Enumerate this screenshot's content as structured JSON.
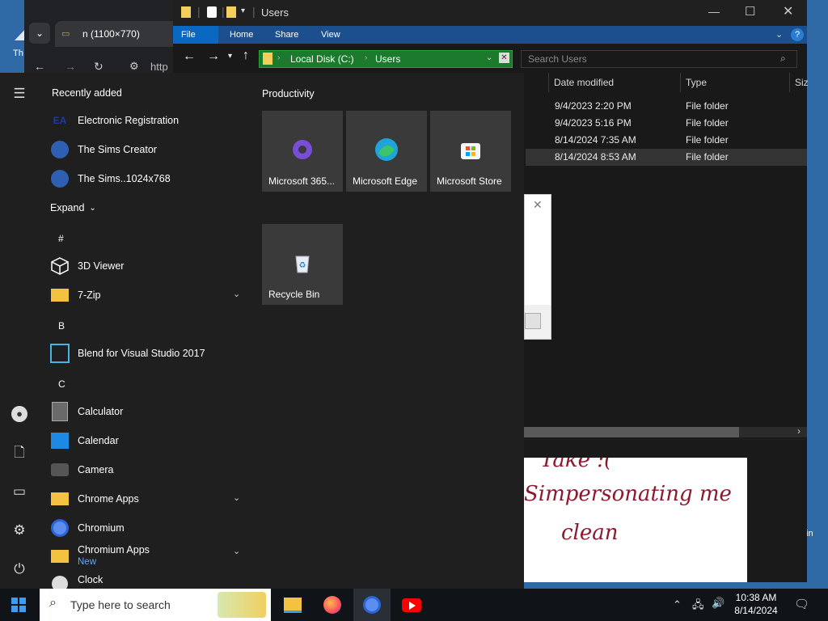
{
  "desktop": {
    "label_left": "Th",
    "label_right": "in"
  },
  "browser": {
    "tab_title": "n (1100×770)",
    "url_fragment": "http"
  },
  "explorer": {
    "title": "Users",
    "ribbon_tabs": [
      "File",
      "Home",
      "Share",
      "View"
    ],
    "address": {
      "segment1": "Local Disk (C:)",
      "segment2": "Users"
    },
    "search_placeholder": "Search Users",
    "columns": [
      "Date modified",
      "Type",
      "Siz"
    ],
    "rows": [
      {
        "date": "9/4/2023 2:20 PM",
        "type": "File folder"
      },
      {
        "date": "9/4/2023 5:16 PM",
        "type": "File folder"
      },
      {
        "date": "8/14/2024 7:35 AM",
        "type": "File folder"
      },
      {
        "date": "8/14/2024 8:53 AM",
        "type": "File folder"
      }
    ]
  },
  "image_window": {
    "line1": "Take :(",
    "line2": "Simpersonating me",
    "line3": "clean"
  },
  "start_menu": {
    "recently_added_header": "Recently added",
    "recent": [
      {
        "label": "Electronic Registration",
        "icon": "ea-logo-icon"
      },
      {
        "label": "The Sims Creator",
        "icon": "sims-icon"
      },
      {
        "label": "The Sims..1024x768",
        "icon": "sims-icon"
      }
    ],
    "expand_label": "Expand",
    "groups": [
      {
        "letter": "#"
      },
      {
        "letter": "B"
      },
      {
        "letter": "C"
      }
    ],
    "apps": [
      {
        "label": "3D Viewer",
        "icon": "3d-viewer-icon"
      },
      {
        "label": "7-Zip",
        "icon": "folder-icon"
      },
      {
        "label": "Blend for Visual Studio 2017",
        "icon": "blend-icon"
      },
      {
        "label": "Calculator",
        "icon": "calculator-icon"
      },
      {
        "label": "Calendar",
        "icon": "calendar-icon"
      },
      {
        "label": "Camera",
        "icon": "camera-icon"
      },
      {
        "label": "Chrome Apps",
        "icon": "folder-icon"
      },
      {
        "label": "Chromium",
        "icon": "chromium-icon"
      },
      {
        "label": "Chromium Apps",
        "icon": "folder-icon",
        "badge": "New"
      },
      {
        "label": "Clock",
        "icon": "clock-icon"
      }
    ],
    "productivity_header": "Productivity",
    "tiles": [
      {
        "label": "Microsoft 365...",
        "icon": "microsoft-365-icon"
      },
      {
        "label": "Microsoft Edge",
        "icon": "edge-icon"
      },
      {
        "label": "Microsoft Store",
        "icon": "store-icon"
      },
      {
        "label": "Recycle Bin",
        "icon": "recycle-bin-icon"
      }
    ]
  },
  "taskbar": {
    "search_placeholder": "Type here to search",
    "time": "10:38 AM",
    "date": "8/14/2024"
  },
  "colors": {
    "accent": "#1c4f8e",
    "address_bg": "#1b7a2b",
    "start_bg": "#1f1f1f",
    "tile_bg": "#3a3a3a"
  }
}
